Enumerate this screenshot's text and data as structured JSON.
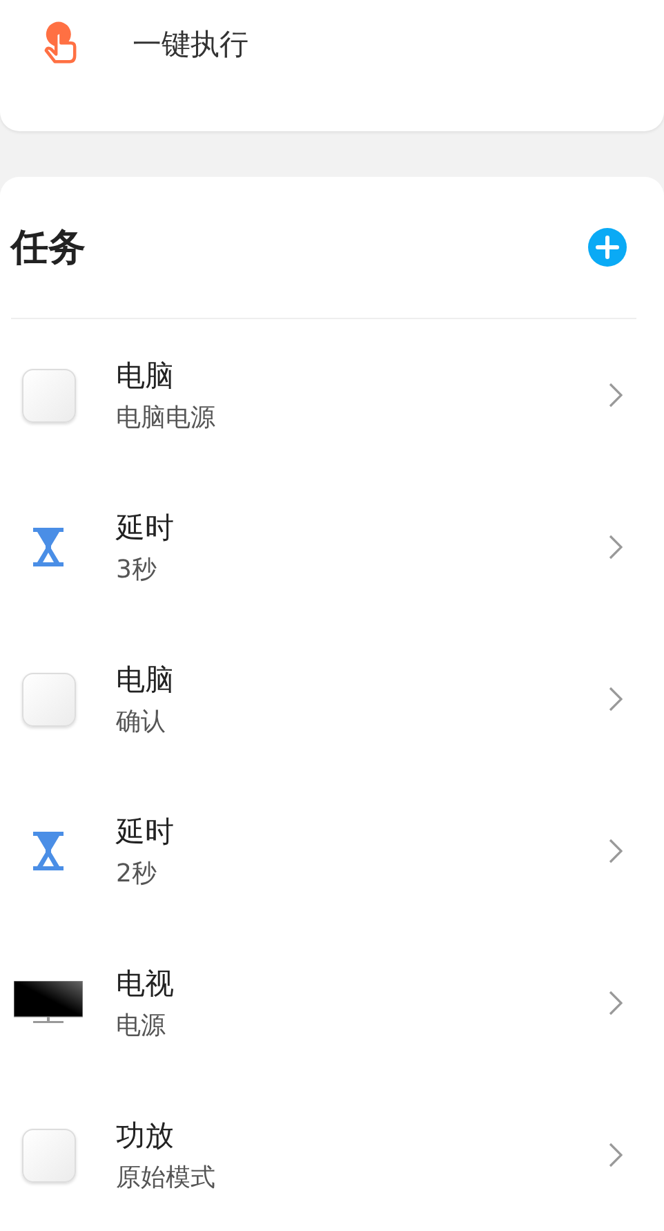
{
  "action": {
    "label": "一键执行"
  },
  "tasks_header": {
    "title": "任务"
  },
  "tasks": [
    {
      "kind": "device",
      "title": "电脑",
      "subtitle": "电脑电源"
    },
    {
      "kind": "timer",
      "title": "延时",
      "subtitle": "3秒"
    },
    {
      "kind": "device",
      "title": "电脑",
      "subtitle": "确认"
    },
    {
      "kind": "timer",
      "title": "延时",
      "subtitle": "2秒"
    },
    {
      "kind": "tv",
      "title": "电视",
      "subtitle": "电源"
    },
    {
      "kind": "device",
      "title": "功放",
      "subtitle": "原始模式"
    }
  ]
}
